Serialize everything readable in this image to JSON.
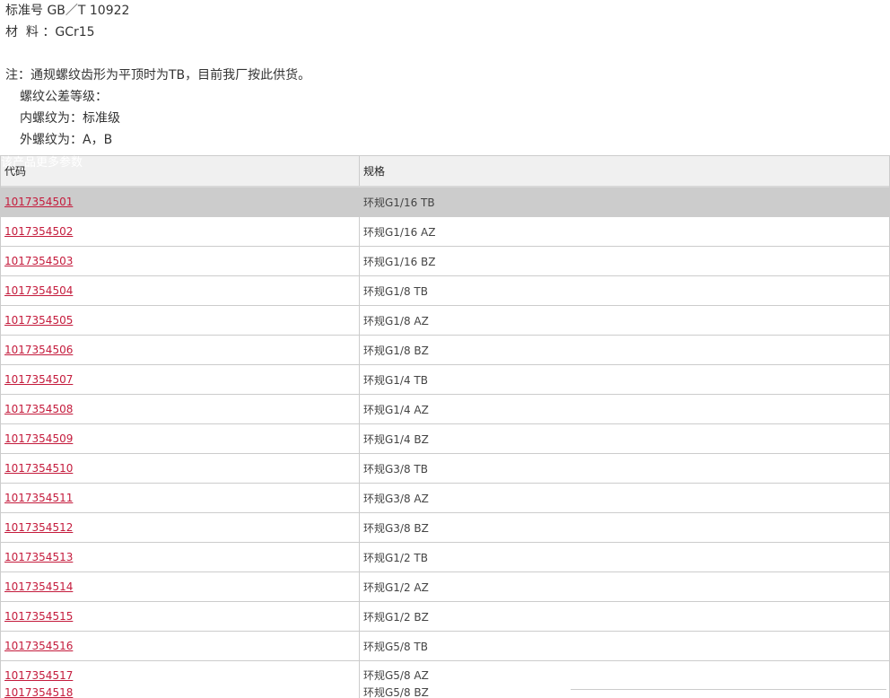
{
  "info": {
    "standard": "标准号 GB／T 10922",
    "material": "材  料 ：GCr15",
    "note": "注：通规螺纹齿形为平顶时为TB，目前我厂按此供货。",
    "tolerance_title": "螺纹公差等级：",
    "internal": "内螺纹为：标准级",
    "external": "外螺纹为：A，B"
  },
  "table": {
    "overlay_text": "该产品更多参数",
    "headers": {
      "code": "代码",
      "spec": "规格"
    },
    "rows": [
      {
        "code": "1017354501",
        "spec": "环规G1/16 TB"
      },
      {
        "code": "1017354502",
        "spec": "环规G1/16 AZ"
      },
      {
        "code": "1017354503",
        "spec": "环规G1/16 BZ"
      },
      {
        "code": "1017354504",
        "spec": "环规G1/8 TB"
      },
      {
        "code": "1017354505",
        "spec": "环规G1/8 AZ"
      },
      {
        "code": "1017354506",
        "spec": "环规G1/8 BZ"
      },
      {
        "code": "1017354507",
        "spec": "环规G1/4 TB"
      },
      {
        "code": "1017354508",
        "spec": "环规G1/4 AZ"
      },
      {
        "code": "1017354509",
        "spec": "环规G1/4 BZ"
      },
      {
        "code": "1017354510",
        "spec": "环规G3/8 TB"
      },
      {
        "code": "1017354511",
        "spec": "环规G3/8 AZ"
      },
      {
        "code": "1017354512",
        "spec": "环规G3/8 BZ"
      },
      {
        "code": "1017354513",
        "spec": "环规G1/2 TB"
      },
      {
        "code": "1017354514",
        "spec": "环规G1/2 AZ"
      },
      {
        "code": "1017354515",
        "spec": "环规G1/2 BZ"
      },
      {
        "code": "1017354516",
        "spec": "环规G5/8 TB"
      },
      {
        "code": "1017354517",
        "spec": "环规G5/8 AZ"
      },
      {
        "code": "1017354518",
        "spec": "环规G5/8 BZ"
      }
    ]
  },
  "colors": {
    "link": "#c41b3c",
    "highlight_row": "#cccccc",
    "header_bg": "#f0f0f0",
    "border": "#cccccc"
  }
}
